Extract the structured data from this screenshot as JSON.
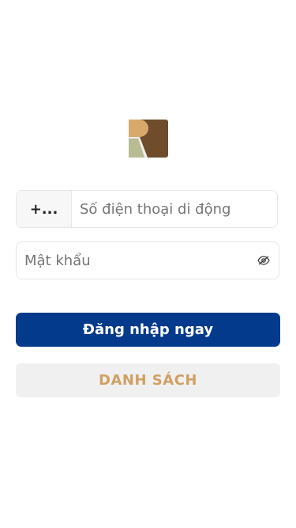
{
  "logo": {
    "icon": "brand-logo-r",
    "colors": {
      "tan": "#d7a96a",
      "brown": "#6e4c2c",
      "sage": "#b9bb92"
    }
  },
  "login_form": {
    "country_code": "+...",
    "phone_placeholder": "Số điện thoại di động",
    "password_placeholder": "Mật khẩu",
    "password_toggle_icon": "eye-icon",
    "login_label": "Đăng nhập ngay",
    "register_label": "DANH SÁCH"
  },
  "colors": {
    "primary": "#033a8c",
    "accent": "#d0a062",
    "secondary_bg": "#f0f0f0",
    "border": "#e6e6e6"
  }
}
